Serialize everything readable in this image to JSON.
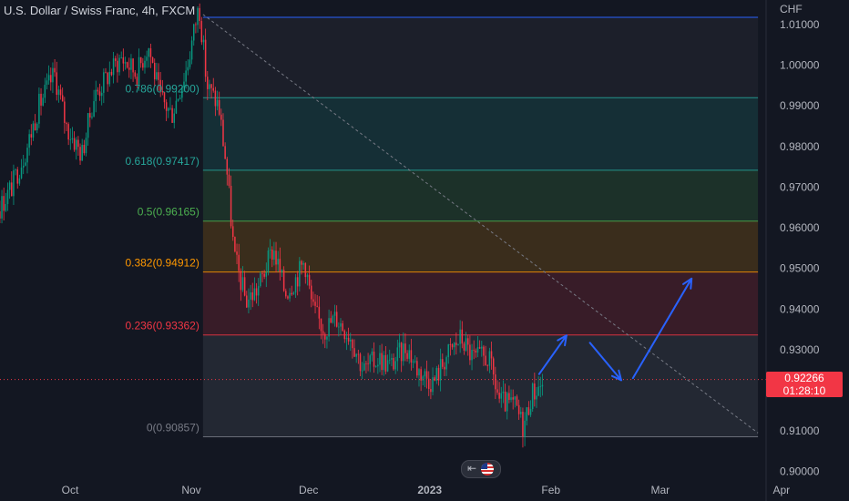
{
  "header": {
    "symbol": "U.S. Dollar / Swiss Franc, 4h, FXCM",
    "currency": "CHF"
  },
  "price_badge": {
    "price": "0.92266",
    "countdown": "01:28:10",
    "color": "#f23645"
  },
  "chart_data": {
    "type": "candlestick",
    "y_range": [
      0.9,
      1.01
    ],
    "y_ticks": [
      {
        "value": 1.01,
        "label": "1.01000"
      },
      {
        "value": 1.0,
        "label": "1.00000"
      },
      {
        "value": 0.99,
        "label": "0.99000"
      },
      {
        "value": 0.98,
        "label": "0.98000"
      },
      {
        "value": 0.97,
        "label": "0.97000"
      },
      {
        "value": 0.96,
        "label": "0.96000"
      },
      {
        "value": 0.95,
        "label": "0.95000"
      },
      {
        "value": 0.94,
        "label": "0.94000"
      },
      {
        "value": 0.93,
        "label": "0.93000"
      },
      {
        "value": 0.91,
        "label": "0.91000"
      },
      {
        "value": 0.9,
        "label": "0.90000"
      }
    ],
    "x_ticks": [
      {
        "date": "2022-10-01",
        "label": "Oct",
        "bold": false
      },
      {
        "date": "2022-11-01",
        "label": "Nov",
        "bold": false
      },
      {
        "date": "2022-12-01",
        "label": "Dec",
        "bold": false
      },
      {
        "date": "2023-01-01",
        "label": "2023",
        "bold": true
      },
      {
        "date": "2023-02-01",
        "label": "Feb",
        "bold": false
      },
      {
        "date": "2023-03-01",
        "label": "Mar",
        "bold": false
      },
      {
        "date": "2023-04-01",
        "label": "Apr",
        "bold": false
      }
    ],
    "price_path": [
      [
        "2022-09-01",
        0.955
      ],
      [
        "2022-09-05",
        0.962
      ],
      [
        "2022-09-08",
        0.967
      ],
      [
        "2022-09-13",
        0.965
      ],
      [
        "2022-09-16",
        0.97
      ],
      [
        "2022-09-20",
        0.98
      ],
      [
        "2022-09-23",
        0.99
      ],
      [
        "2022-09-27",
        0.998
      ],
      [
        "2022-09-30",
        0.985
      ],
      [
        "2022-10-04",
        0.978
      ],
      [
        "2022-10-07",
        0.992
      ],
      [
        "2022-10-11",
        0.998
      ],
      [
        "2022-10-14",
        1.002
      ],
      [
        "2022-10-18",
        0.998
      ],
      [
        "2022-10-21",
        1.005
      ],
      [
        "2022-10-24",
        0.992
      ],
      [
        "2022-10-27",
        0.988
      ],
      [
        "2022-10-31",
        1.0
      ],
      [
        "2022-11-03",
        1.015
      ],
      [
        "2022-11-05",
        0.995
      ],
      [
        "2022-11-08",
        0.99
      ],
      [
        "2022-11-10",
        0.975
      ],
      [
        "2022-11-12",
        0.953
      ],
      [
        "2022-11-15",
        0.942
      ],
      [
        "2022-11-18",
        0.945
      ],
      [
        "2022-11-22",
        0.955
      ],
      [
        "2022-11-25",
        0.944
      ],
      [
        "2022-11-28",
        0.948
      ],
      [
        "2022-11-30",
        0.952
      ],
      [
        "2022-12-02",
        0.94
      ],
      [
        "2022-12-05",
        0.935
      ],
      [
        "2022-12-08",
        0.938
      ],
      [
        "2022-12-12",
        0.933
      ],
      [
        "2022-12-15",
        0.925
      ],
      [
        "2022-12-19",
        0.928
      ],
      [
        "2022-12-22",
        0.926
      ],
      [
        "2022-12-26",
        0.931
      ],
      [
        "2022-12-29",
        0.925
      ],
      [
        "2023-01-02",
        0.922
      ],
      [
        "2023-01-05",
        0.928
      ],
      [
        "2023-01-09",
        0.933
      ],
      [
        "2023-01-12",
        0.928
      ],
      [
        "2023-01-16",
        0.928
      ],
      [
        "2023-01-19",
        0.917
      ],
      [
        "2023-01-23",
        0.916
      ],
      [
        "2023-01-25",
        0.911
      ],
      [
        "2023-01-27",
        0.919
      ],
      [
        "2023-01-30",
        0.922
      ]
    ],
    "fibonacci": {
      "levels": [
        {
          "ratio": 0.786,
          "label": "0.786(0.99200)",
          "price": 0.992,
          "color": "#26a69a"
        },
        {
          "ratio": 0.618,
          "label": "0.618(0.97417)",
          "price": 0.97417,
          "color": "#26a69a"
        },
        {
          "ratio": 0.5,
          "label": "0.5(0.96165)",
          "price": 0.96165,
          "color": "#4caf50"
        },
        {
          "ratio": 0.382,
          "label": "0.382(0.94912)",
          "price": 0.94912,
          "color": "#ff9800"
        },
        {
          "ratio": 0.236,
          "label": "0.236(0.93362)",
          "price": 0.93362,
          "color": "#f23645"
        },
        {
          "ratio": 0,
          "label": "0(0.90857)",
          "price": 0.90857,
          "color": "#787b86"
        }
      ],
      "start_date": "2022-11-04",
      "end_date": "2023-03-26"
    },
    "trend_line": {
      "from": [
        "2022-11-04",
        1.0125
      ],
      "to": [
        "2023-03-26",
        0.9095
      ]
    },
    "current_price": 0.92266,
    "projection": [
      [
        "2023-01-29",
        0.924
      ],
      [
        "2023-02-05",
        0.9335
      ],
      [
        "2023-02-11",
        0.9317
      ],
      [
        "2023-02-19",
        0.9225
      ],
      [
        "2023-02-22",
        0.923
      ],
      [
        "2023-03-09",
        0.9475
      ]
    ]
  }
}
